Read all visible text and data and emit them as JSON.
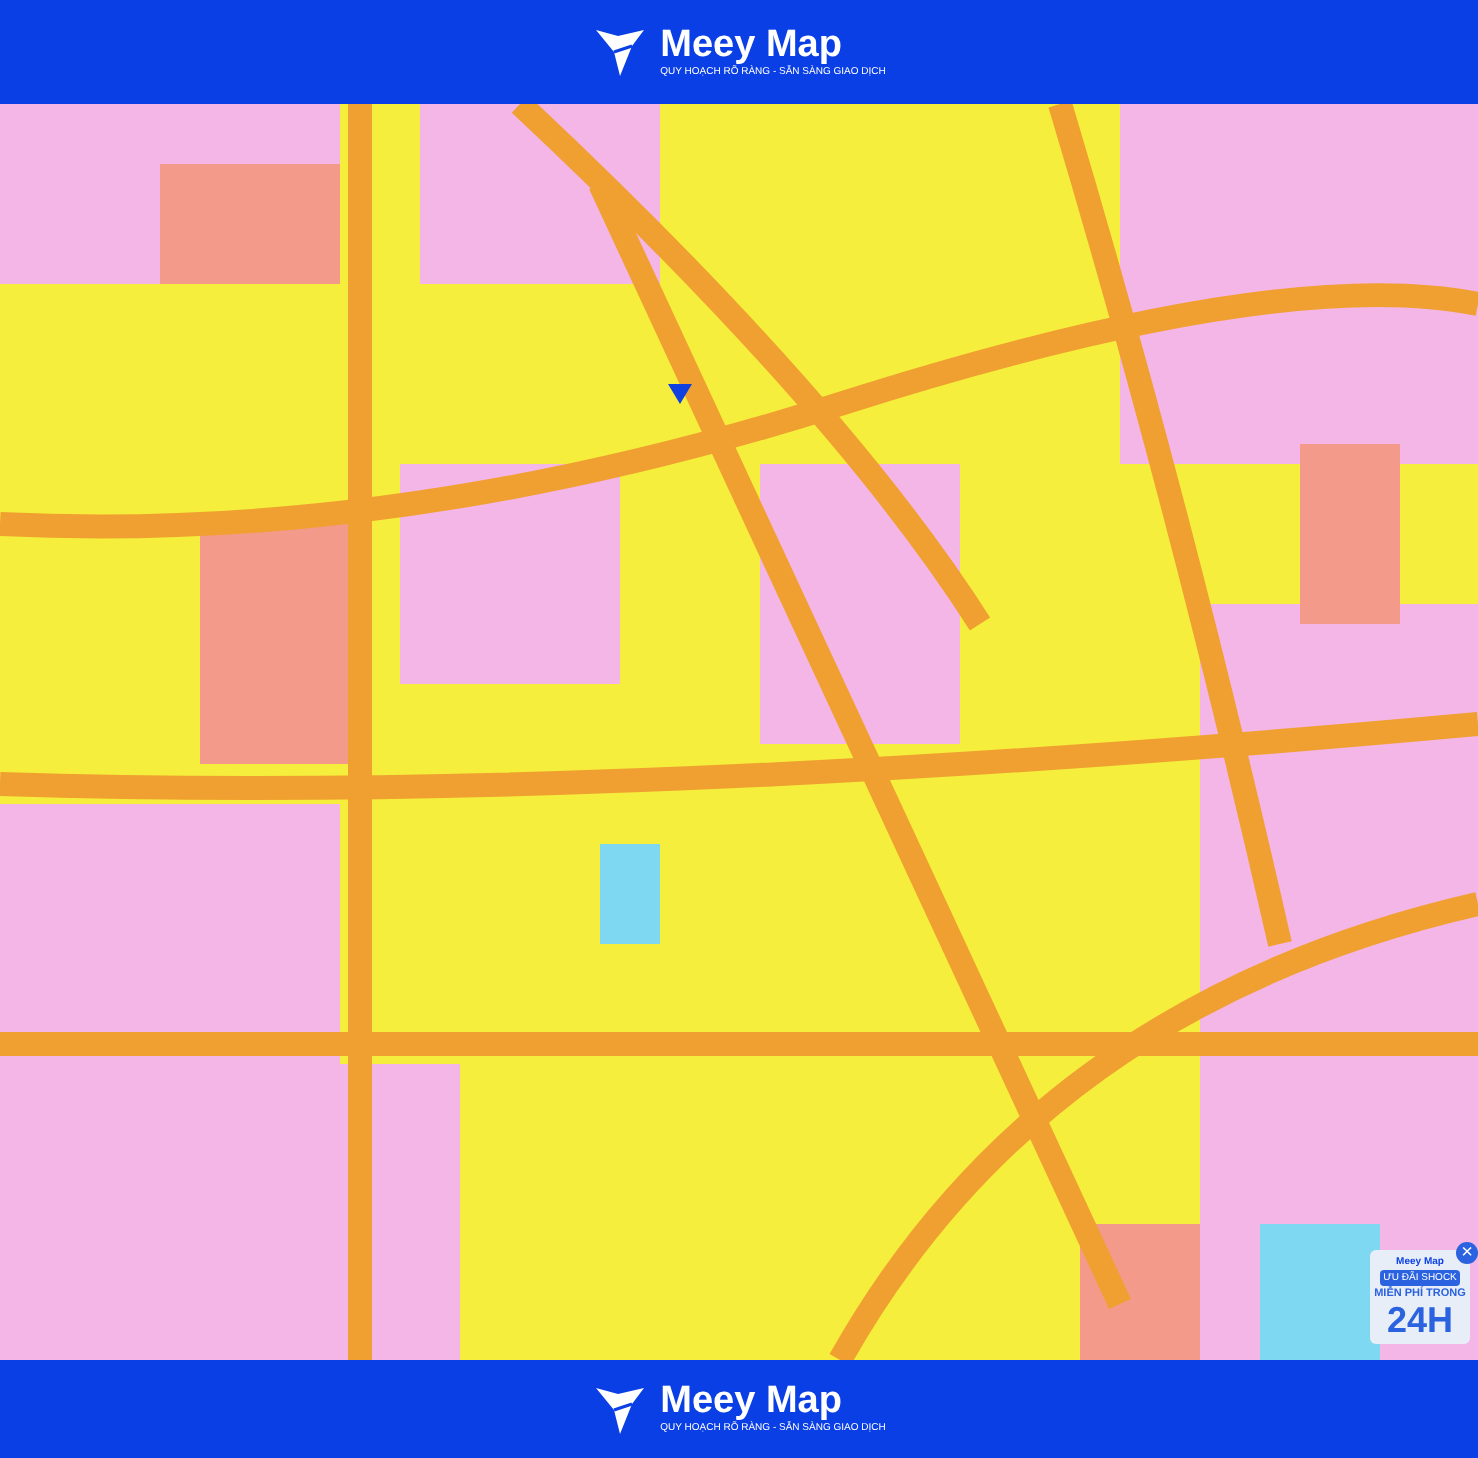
{
  "header": {
    "brand": "Meey Map",
    "tagline": "QUY HOẠCH RÕ RÀNG - SẴN SÀNG GIAO DỊCH"
  },
  "ad": {
    "brand": "Meey Map",
    "badge": "ƯU ĐÃI SHOCK",
    "headline": "MIỄN PHÍ TRONG",
    "big": "24H",
    "close": "×"
  },
  "footer": {
    "brand": "Meey Map",
    "tagline": "QUY HOẠCH RÕ RÀNG - SẴN SÀNG GIAO DỊCH"
  }
}
